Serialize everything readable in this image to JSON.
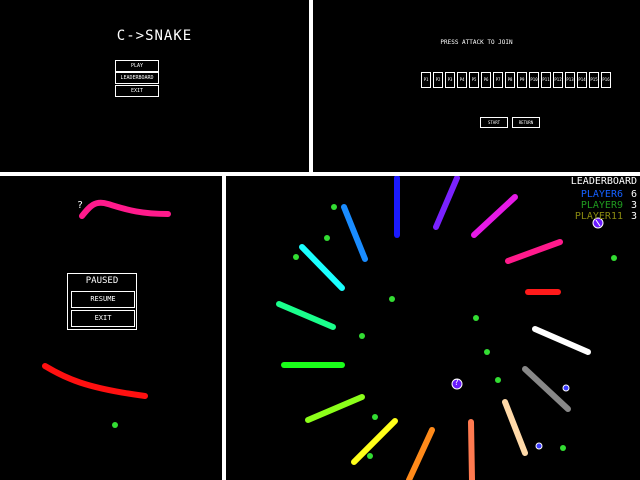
{
  "menu": {
    "title": "C->SNAKE",
    "buttons": [
      "PLAY",
      "LEADERBOARD",
      "EXIT"
    ]
  },
  "join": {
    "prompt": "PRESS ATTACK TO JOIN",
    "slots": [
      "P1",
      "P2",
      "P3",
      "P4",
      "P5",
      "P6",
      "P7",
      "P8",
      "P9",
      "P10",
      "P11",
      "P12",
      "P13",
      "P14",
      "P15",
      "P16"
    ],
    "start_label": "START",
    "return_label": "RETURN"
  },
  "pause": {
    "mystery_glyph": "?",
    "title": "PAUSED",
    "resume_label": "RESUME",
    "exit_label": "EXIT"
  },
  "leaderboard": {
    "title": "LEADERBOARD",
    "rows": [
      {
        "name": "PLAYER6",
        "score": "6",
        "color": "#1560ff"
      },
      {
        "name": "PLAYER9",
        "score": "3",
        "color": "#1f9a1f"
      },
      {
        "name": "PLAYER11",
        "score": "3",
        "color": "#8a8a10"
      }
    ],
    "powerup_glyph": "?"
  },
  "colors": {
    "background": "#000000",
    "outline": "#ffffff",
    "pellet": "#33dd33",
    "powerup": "#7733ff"
  }
}
